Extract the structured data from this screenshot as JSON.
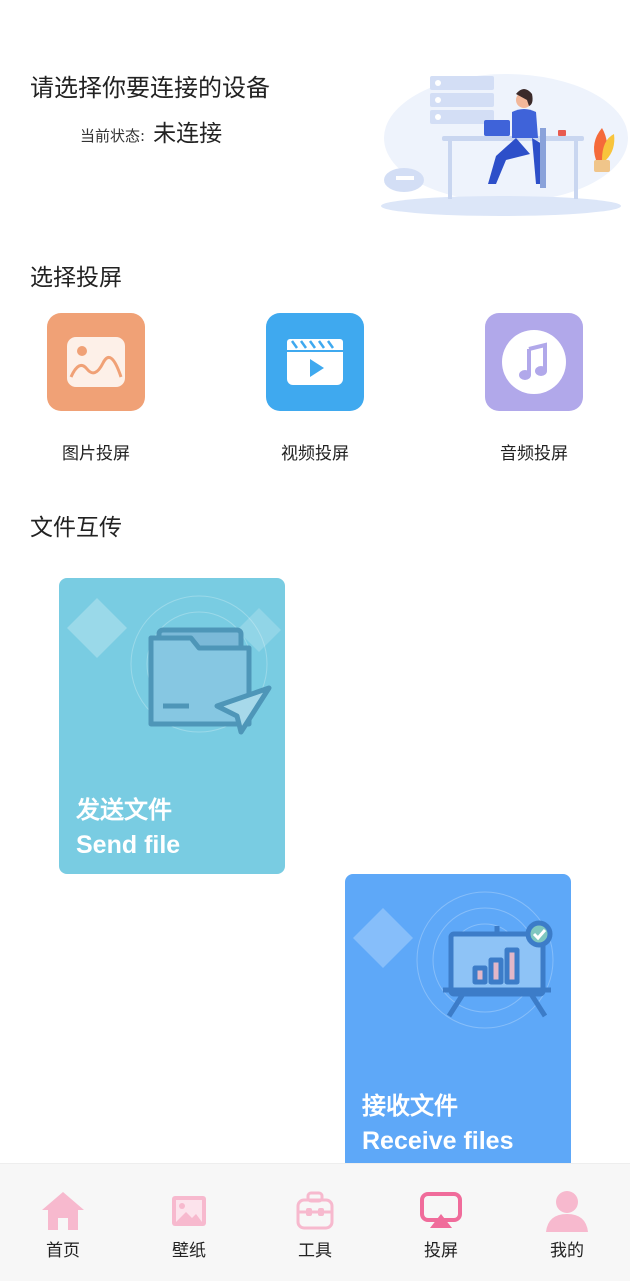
{
  "header": {
    "title": "请选择你要连接的设备",
    "status_label": "当前状态:",
    "status_value": "未连接"
  },
  "cast_section": {
    "title": "选择投屏",
    "items": [
      {
        "label": "图片投屏",
        "icon": "image-icon",
        "color": "#F0A176"
      },
      {
        "label": "视频投屏",
        "icon": "video-icon",
        "color": "#3FA9EF"
      },
      {
        "label": "音频投屏",
        "icon": "music-icon",
        "color": "#B1A8EA"
      }
    ]
  },
  "file_section": {
    "title": "文件互传",
    "cards": [
      {
        "zh": "发送文件",
        "en": "Send file",
        "icon": "folder-send-icon",
        "color": "#79CCE2"
      },
      {
        "zh": "接收文件",
        "en": "Receive files",
        "icon": "presentation-board-icon",
        "color": "#5EA8F8"
      }
    ]
  },
  "tabbar": {
    "active_color": "#F06C9B",
    "icon_color": "#F7B9CE",
    "items": [
      {
        "label": "首页",
        "icon": "home-icon"
      },
      {
        "label": "壁纸",
        "icon": "wallpaper-icon"
      },
      {
        "label": "工具",
        "icon": "toolbox-icon"
      },
      {
        "label": "投屏",
        "icon": "screen-cast-icon",
        "active": true
      },
      {
        "label": "我的",
        "icon": "profile-icon"
      }
    ]
  }
}
